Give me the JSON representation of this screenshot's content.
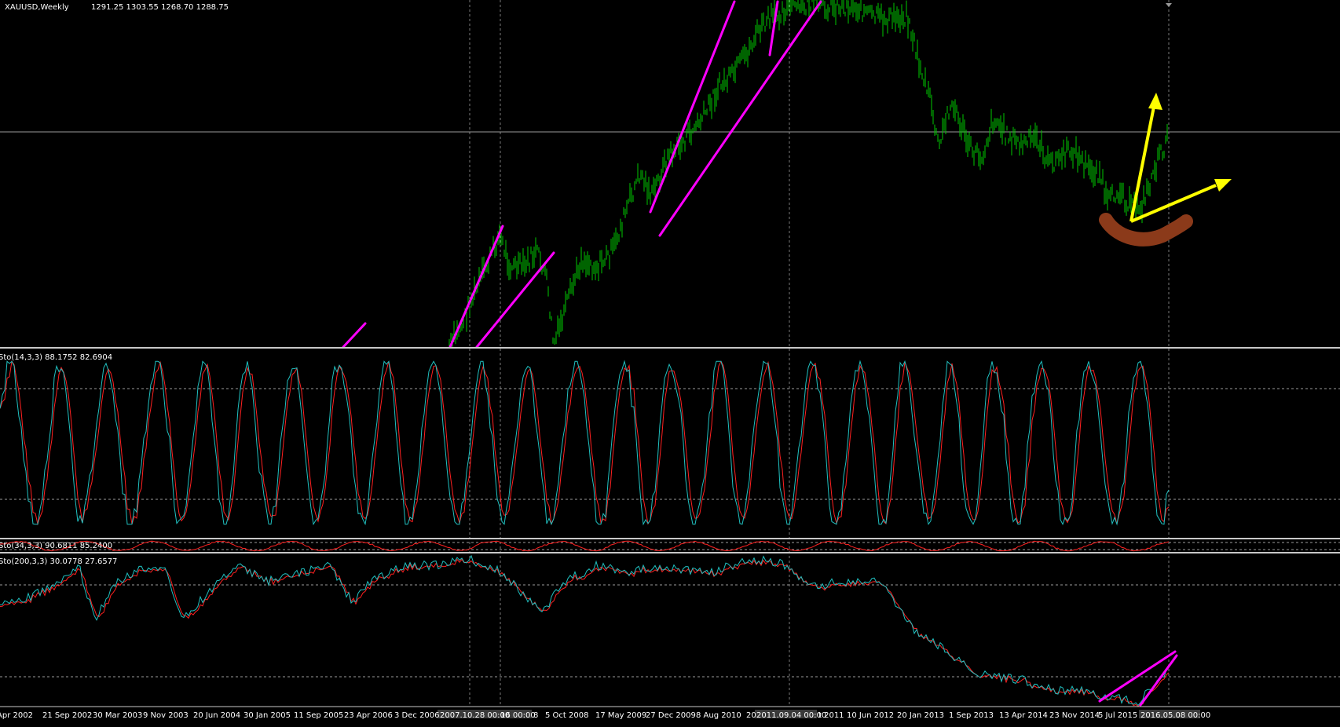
{
  "main_panel": {
    "symbol_label": "XAUUSD,Weekly",
    "ohlc_label": "1291.25 1303.55 1268.70 1288.75"
  },
  "indicators": [
    {
      "label": "Sto(14,3,3) 88.1752 82.6904"
    },
    {
      "label": "Sto(34,3,3) 90.6811 85.2400"
    },
    {
      "label": "Sto(200,3,3) 30.0778 27.6577"
    }
  ],
  "time_axis": [
    " Apr 2002",
    "21 Sep 2002",
    "30 Mar 2003",
    "9 Nov 2003",
    "20 Jun 2004",
    "30 Jan 2005",
    "11 Sep 2005",
    "23 Apr 2006",
    "3 Dec 2006",
    "2007.10.28 00:00",
    "16 00:00",
    "8",
    "5 Oct 2008",
    "17 May 2009",
    "27 Dec 2009",
    "8 Aug 2010",
    "20",
    "2011.09.04 00:00",
    "t 2011",
    "10 Jun 2012",
    "20 Jan 2013",
    "1 Sep 2013",
    "13 Apr 2014",
    "23 Nov 2014",
    "5 Jul 2015",
    "2016.05.08 00:00"
  ],
  "colors": {
    "background": "#000000",
    "bars": "#00c800",
    "trendline": "#ff00ff",
    "arrow": "#ffff00",
    "highlight": "#8b3a1a",
    "stoch_main": "#20c0c0",
    "stoch_signal": "#ff2020",
    "grid": "#808080",
    "text": "#ffffff"
  }
}
